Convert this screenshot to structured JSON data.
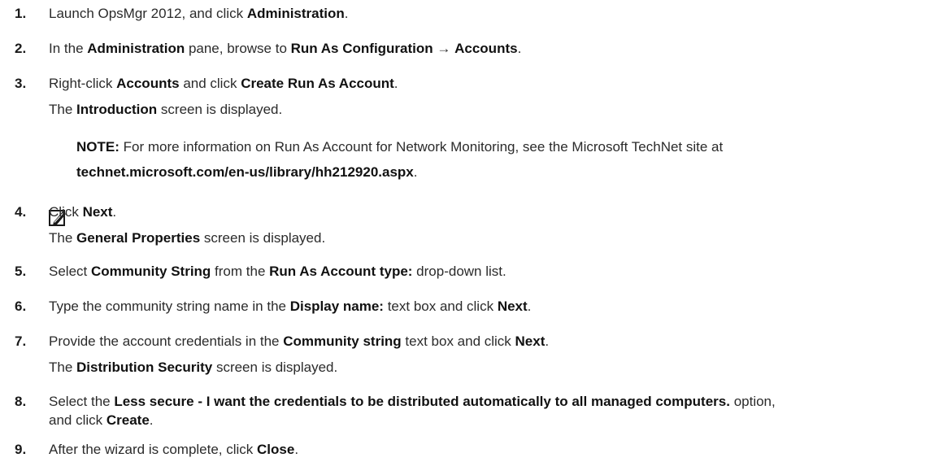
{
  "steps": [
    {
      "num": "1.",
      "parts": [
        "Launch OpsMgr 2012, and click ",
        "Administration",
        "."
      ]
    },
    {
      "num": "2.",
      "parts": [
        "In the ",
        "Administration",
        " pane, browse to ",
        "Run As Configuration",
        " → ",
        "Accounts",
        "."
      ]
    },
    {
      "num": "3.",
      "parts": [
        "Right-click ",
        "Accounts",
        " and click ",
        "Create Run As Account",
        "."
      ],
      "sub": [
        "The ",
        "Introduction",
        " screen is displayed."
      ]
    },
    {
      "num": "4.",
      "parts": [
        "Click ",
        "Next",
        "."
      ],
      "sub": [
        "The ",
        "General Properties",
        " screen is displayed."
      ]
    },
    {
      "num": "5.",
      "parts": [
        "Select ",
        "Community String",
        " from the ",
        "Run As Account type:",
        " drop-down list."
      ]
    },
    {
      "num": "6.",
      "parts": [
        "Type the community string name in the ",
        "Display name:",
        " text box and click ",
        "Next",
        "."
      ]
    },
    {
      "num": "7.",
      "parts": [
        "Provide the account credentials in the ",
        "Community string",
        " text box and click ",
        "Next",
        "."
      ],
      "sub": [
        "The ",
        "Distribution Security",
        " screen is displayed."
      ]
    },
    {
      "num": "8.",
      "parts": [
        "Select the ",
        "Less secure - I want the credentials to be distributed automatically to all managed computers.",
        " option,"
      ],
      "cont": [
        "and click ",
        "Create",
        "."
      ]
    },
    {
      "num": "9.",
      "parts": [
        "After the wizard is complete, click ",
        "Close",
        "."
      ]
    }
  ],
  "note": {
    "label": "NOTE:",
    "text1": " For more information on Run As Account for Network Monitoring, see the Microsoft TechNet site at",
    "link": "technet.microsoft.com/en-us/library/hh212920.aspx",
    "end": "."
  },
  "note_icon": "pencil-note-icon"
}
